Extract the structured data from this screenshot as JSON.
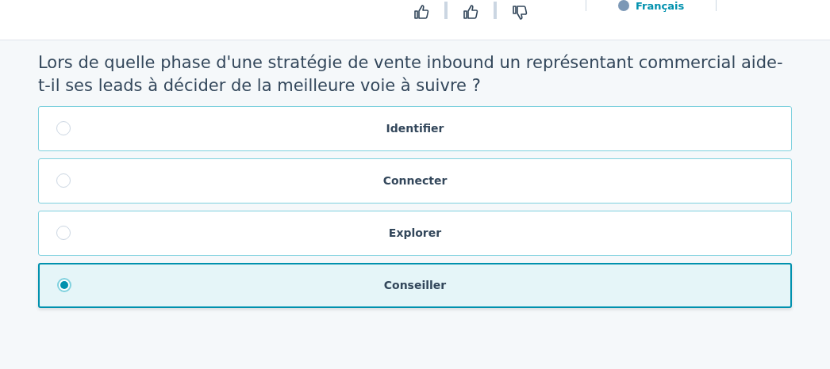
{
  "header": {
    "feedback": [
      {
        "kind": "thumbs-up-outline"
      },
      {
        "kind": "thumbs-up"
      },
      {
        "kind": "thumbs-down"
      }
    ],
    "language": "Français"
  },
  "question": "Lors de quelle phase d'une stratégie de vente inbound un représentant commercial aide-t-il ses leads à décider de la meilleure voie à suivre ?",
  "options": [
    {
      "label": "Identifier",
      "selected": false
    },
    {
      "label": "Connecter",
      "selected": false
    },
    {
      "label": "Explorer",
      "selected": false
    },
    {
      "label": "Conseiller",
      "selected": true
    }
  ]
}
